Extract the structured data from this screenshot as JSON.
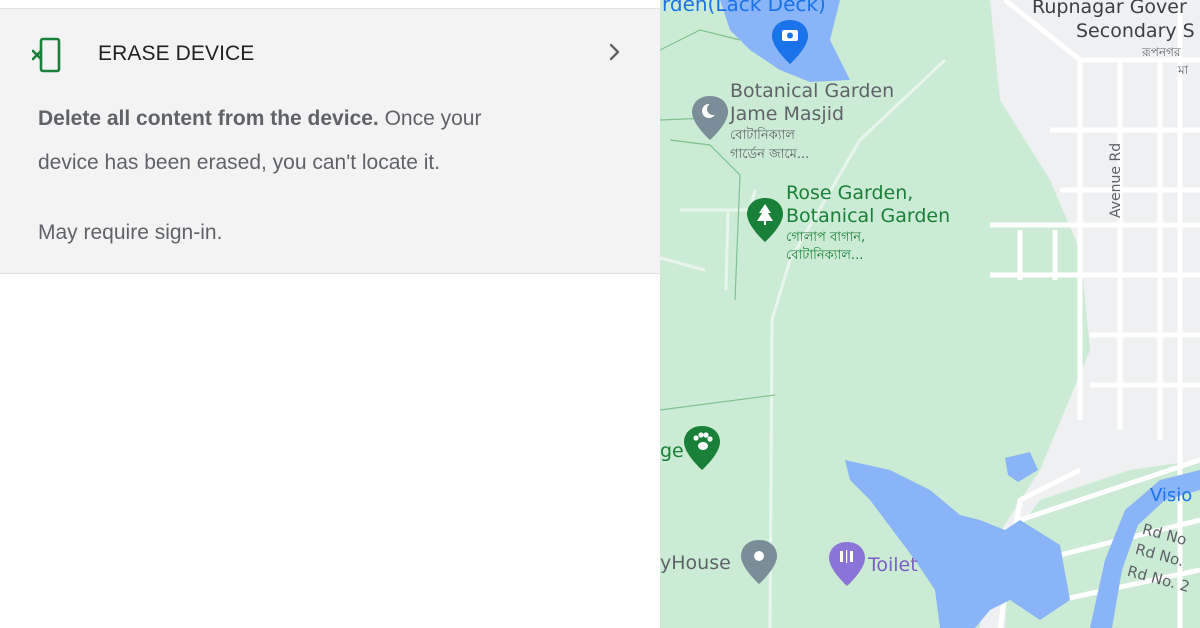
{
  "erase": {
    "title": "ERASE DEVICE",
    "desc_bold": "Delete all content from the device.",
    "desc_rest": " Once your device has been erased, you can't locate it.",
    "note": "May require sign-in.",
    "icon": "erase-phone-icon",
    "accent": "#188038"
  },
  "map": {
    "labels": {
      "lake_deck": "rden(Lack Deck)",
      "rupnagar1": "Rupnagar Gover",
      "rupnagar2": "Secondary S",
      "rupnagar_bn1": "রূপনগর",
      "rupnagar_bn2": "মা",
      "mosque1": "Botanical Garden",
      "mosque2": "Jame Masjid",
      "mosque_bn1": "বোটানিক্যাল",
      "mosque_bn2": "গার্ডেন জামে...",
      "rose1": "Rose Garden,",
      "rose2": "Botanical Garden",
      "rose_bn1": "গোলাপ বাগান,",
      "rose_bn2": "বোটানিক্যাল...",
      "avenue": "Avenue Rd",
      "ge": "ge",
      "yhouse": "yHouse",
      "toilet": "Toilet",
      "visio": "Visio",
      "rdno1": "Rd No",
      "rdno2": "Rd No.",
      "rdno3": "Rd No. 2"
    },
    "colors": {
      "park": "#ccebd4",
      "water": "#8ab4f8",
      "road": "#ffffff",
      "urban": "#e8eaed"
    }
  }
}
